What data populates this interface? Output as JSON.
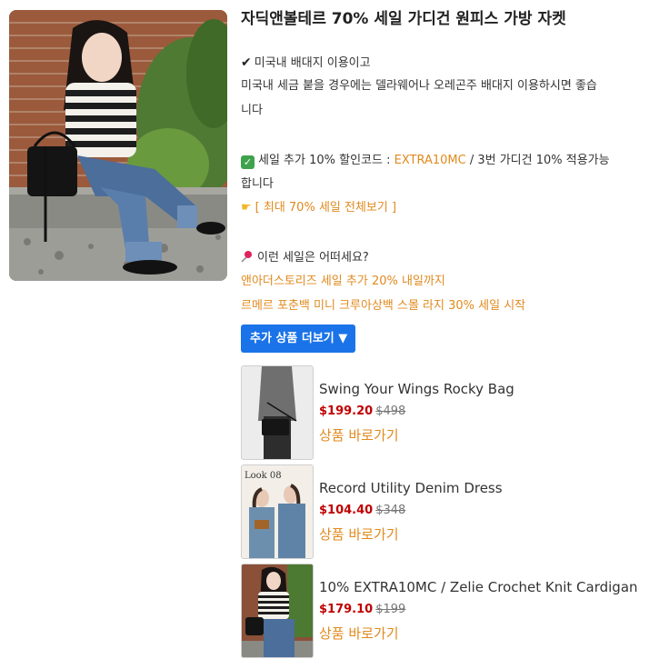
{
  "title": "자딕앤볼테르 70% 세일 가디건 원피스 가방 자켓",
  "shipping": {
    "line1": "미국내 배대지 이용이고",
    "line2": "미국내 세금 붙을 경우에는 델라웨어나 오레곤주 배대지 이용하시면 좋습",
    "line3": "니다"
  },
  "coupon": {
    "prefix": "세일 추가 10% 할인코드 : ",
    "code": "EXTRA10MC",
    "suffix": " / 3번 가디건 10% 적용가능",
    "line2": "합니다"
  },
  "view_all_link": "[ 최대 70% 세일 전체보기 ]",
  "other_sales": {
    "heading": "이런 세일은 어떠세요?",
    "links": [
      "앤아더스토리즈 세일 추가 20% 내일까지",
      "르메르 포춘백 미니 크루아상백 스몰 라지 30% 세일 시작"
    ]
  },
  "more_button_label": "추가 상품 더보기 ▼",
  "products": [
    {
      "name": "Swing Your Wings Rocky Bag",
      "sale_price": "$199.20",
      "original_price": "$498",
      "link": "상품 바로가기"
    },
    {
      "name": "Record Utility Denim Dress",
      "sale_price": "$104.40",
      "original_price": "$348",
      "link": "상품 바로가기"
    },
    {
      "name": "10% EXTRA10MC / Zelie Crochet Knit Cardigan",
      "sale_price": "$179.10",
      "original_price": "$199",
      "link": "상품 바로가기"
    }
  ],
  "thumb_text": {
    "lookbook": "Look 08"
  },
  "colors": {
    "accent_orange": "#e08a1e",
    "button_blue": "#1a73e8",
    "sale_red": "#c00000"
  },
  "icons": [
    "check-icon",
    "green-check-icon",
    "pointing-hand-icon",
    "pushpin-icon"
  ]
}
